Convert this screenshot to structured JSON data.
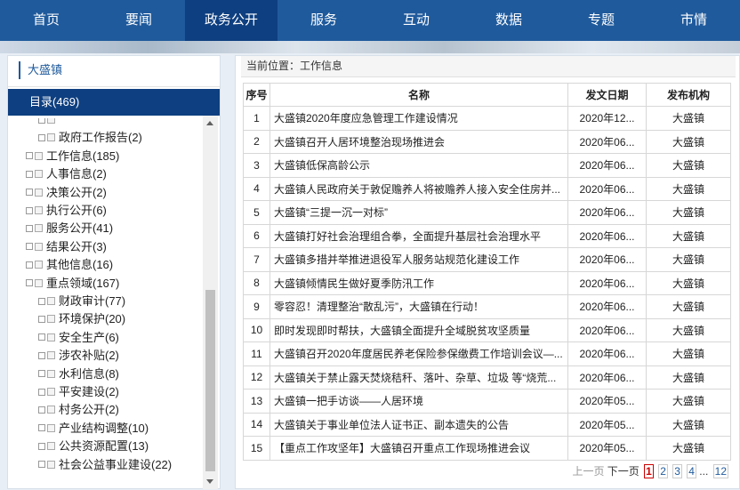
{
  "nav": [
    "首页",
    "要闻",
    "政务公开",
    "服务",
    "互动",
    "数据",
    "专题",
    "市情"
  ],
  "sidebar": {
    "title": "大盛镇",
    "catalog": "目录(469)",
    "items": [
      {
        "label": "",
        "indent": 2
      },
      {
        "label": "政府工作报告(2)",
        "indent": 2
      },
      {
        "label": "工作信息(185)",
        "indent": 1
      },
      {
        "label": "人事信息(2)",
        "indent": 1
      },
      {
        "label": "决策公开(2)",
        "indent": 1
      },
      {
        "label": "执行公开(6)",
        "indent": 1
      },
      {
        "label": "服务公开(41)",
        "indent": 1
      },
      {
        "label": "结果公开(3)",
        "indent": 1
      },
      {
        "label": "其他信息(16)",
        "indent": 1
      },
      {
        "label": "重点领域(167)",
        "indent": 1
      },
      {
        "label": "财政审计(77)",
        "indent": 2
      },
      {
        "label": "环境保护(20)",
        "indent": 2
      },
      {
        "label": "安全生产(6)",
        "indent": 2
      },
      {
        "label": "涉农补贴(2)",
        "indent": 2
      },
      {
        "label": "水利信息(8)",
        "indent": 2
      },
      {
        "label": "平安建设(2)",
        "indent": 2
      },
      {
        "label": "村务公开(2)",
        "indent": 2
      },
      {
        "label": "产业结构调整(10)",
        "indent": 2
      },
      {
        "label": "公共资源配置(13)",
        "indent": 2
      },
      {
        "label": "社会公益事业建设(22)",
        "indent": 2
      }
    ]
  },
  "main": {
    "breadcrumb": "当前位置：工作信息",
    "headers": [
      "序号",
      "名称",
      "发文日期",
      "发布机构"
    ],
    "rows": [
      [
        "1",
        "大盛镇2020年度应急管理工作建设情况",
        "2020年12...",
        "大盛镇"
      ],
      [
        "2",
        "大盛镇召开人居环境整治现场推进会",
        "2020年06...",
        "大盛镇"
      ],
      [
        "3",
        "大盛镇低保高龄公示",
        "2020年06...",
        "大盛镇"
      ],
      [
        "4",
        "大盛镇人民政府关于敦促赡养人将被赡养人接入安全住房并...",
        "2020年06...",
        "大盛镇"
      ],
      [
        "5",
        "大盛镇“三提一沉一对标”",
        "2020年06...",
        "大盛镇"
      ],
      [
        "6",
        "大盛镇打好社会治理组合拳，全面提升基层社会治理水平",
        "2020年06...",
        "大盛镇"
      ],
      [
        "7",
        "大盛镇多措并举推进退役军人服务站规范化建设工作",
        "2020年06...",
        "大盛镇"
      ],
      [
        "8",
        "大盛镇倾情民生做好夏季防汛工作",
        "2020年06...",
        "大盛镇"
      ],
      [
        "9",
        "零容忍！清理整治“散乱污”，大盛镇在行动！",
        "2020年06...",
        "大盛镇"
      ],
      [
        "10",
        "即时发现即时帮扶，大盛镇全面提升全域脱贫攻坚质量",
        "2020年06...",
        "大盛镇"
      ],
      [
        "11",
        "大盛镇召开2020年度居民养老保险参保缴费工作培训会议—...",
        "2020年06...",
        "大盛镇"
      ],
      [
        "12",
        "大盛镇关于禁止露天焚烧秸秆、落叶、杂草、垃圾 等“烧荒...",
        "2020年06...",
        "大盛镇"
      ],
      [
        "13",
        "大盛镇一把手访谈——人居环境",
        "2020年05...",
        "大盛镇"
      ],
      [
        "14",
        "大盛镇关于事业单位法人证书正、副本遗失的公告",
        "2020年05...",
        "大盛镇"
      ],
      [
        "15",
        "【重点工作攻坚年】大盛镇召开重点工作现场推进会议",
        "2020年05...",
        "大盛镇"
      ]
    ],
    "pager": {
      "prev": "上一页",
      "next": "下一页",
      "pages": [
        "1",
        "2",
        "3",
        "4"
      ],
      "ellipsis": "...",
      "last": "12"
    }
  }
}
